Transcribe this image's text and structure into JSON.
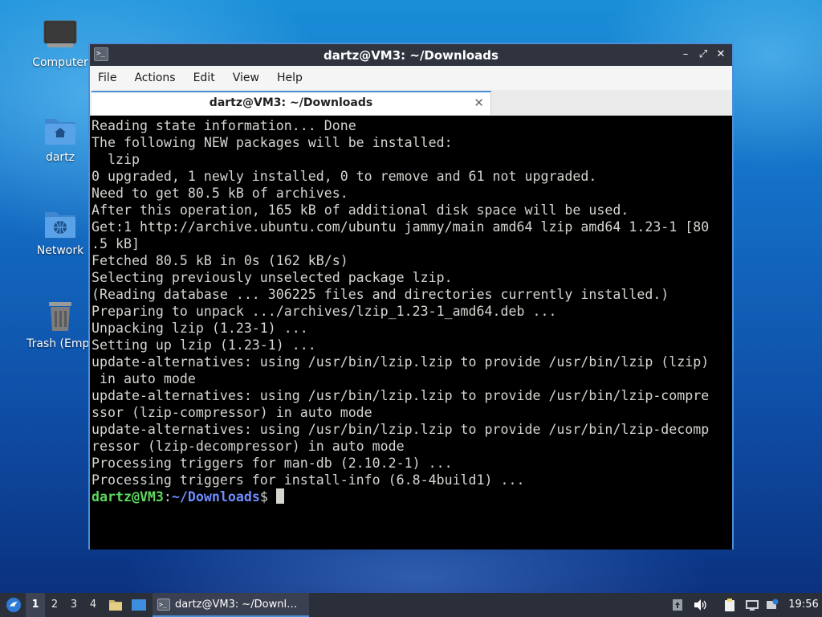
{
  "desktop": {
    "icons": [
      {
        "label": "Computer",
        "icon": "computer-icon"
      },
      {
        "label": "dartz",
        "icon": "home-folder-icon"
      },
      {
        "label": "Network",
        "icon": "network-folder-icon"
      },
      {
        "label": "Trash (Empt",
        "icon": "trash-icon"
      }
    ]
  },
  "window": {
    "title": "dartz@VM3: ~/Downloads",
    "menus": [
      "File",
      "Actions",
      "Edit",
      "View",
      "Help"
    ],
    "tab_label": "dartz@VM3: ~/Downloads",
    "terminal_lines": [
      "Reading state information... Done",
      "The following NEW packages will be installed:",
      "  lzip",
      "0 upgraded, 1 newly installed, 0 to remove and 61 not upgraded.",
      "Need to get 80.5 kB of archives.",
      "After this operation, 165 kB of additional disk space will be used.",
      "Get:1 http://archive.ubuntu.com/ubuntu jammy/main amd64 lzip amd64 1.23-1 [80",
      ".5 kB]",
      "Fetched 80.5 kB in 0s (162 kB/s)",
      "Selecting previously unselected package lzip.",
      "(Reading database ... 306225 files and directories currently installed.)",
      "Preparing to unpack .../archives/lzip_1.23-1_amd64.deb ...",
      "Unpacking lzip (1.23-1) ...",
      "Setting up lzip (1.23-1) ...",
      "update-alternatives: using /usr/bin/lzip.lzip to provide /usr/bin/lzip (lzip)",
      " in auto mode",
      "update-alternatives: using /usr/bin/lzip.lzip to provide /usr/bin/lzip-compre",
      "ssor (lzip-compressor) in auto mode",
      "update-alternatives: using /usr/bin/lzip.lzip to provide /usr/bin/lzip-decomp",
      "ressor (lzip-decompressor) in auto mode",
      "Processing triggers for man-db (2.10.2-1) ...",
      "Processing triggers for install-info (6.8-4build1) ..."
    ],
    "prompt": {
      "user_host": "dartz@VM3",
      "sep": ":",
      "path": "~/Downloads",
      "symbol": "$"
    }
  },
  "taskbar": {
    "workspaces": [
      "1",
      "2",
      "3",
      "4"
    ],
    "active_workspace": "1",
    "task_label": "dartz@VM3: ~/Downl…",
    "clock": "19:56",
    "tray_icons": [
      "update-icon",
      "volume-icon",
      "clipboard-icon",
      "network-icon",
      "notification-icon"
    ]
  },
  "colors": {
    "accent": "#4a8fd8",
    "titlebar": "#2f343f",
    "prompt_user": "#5fd75f",
    "prompt_path": "#6f8cff"
  }
}
